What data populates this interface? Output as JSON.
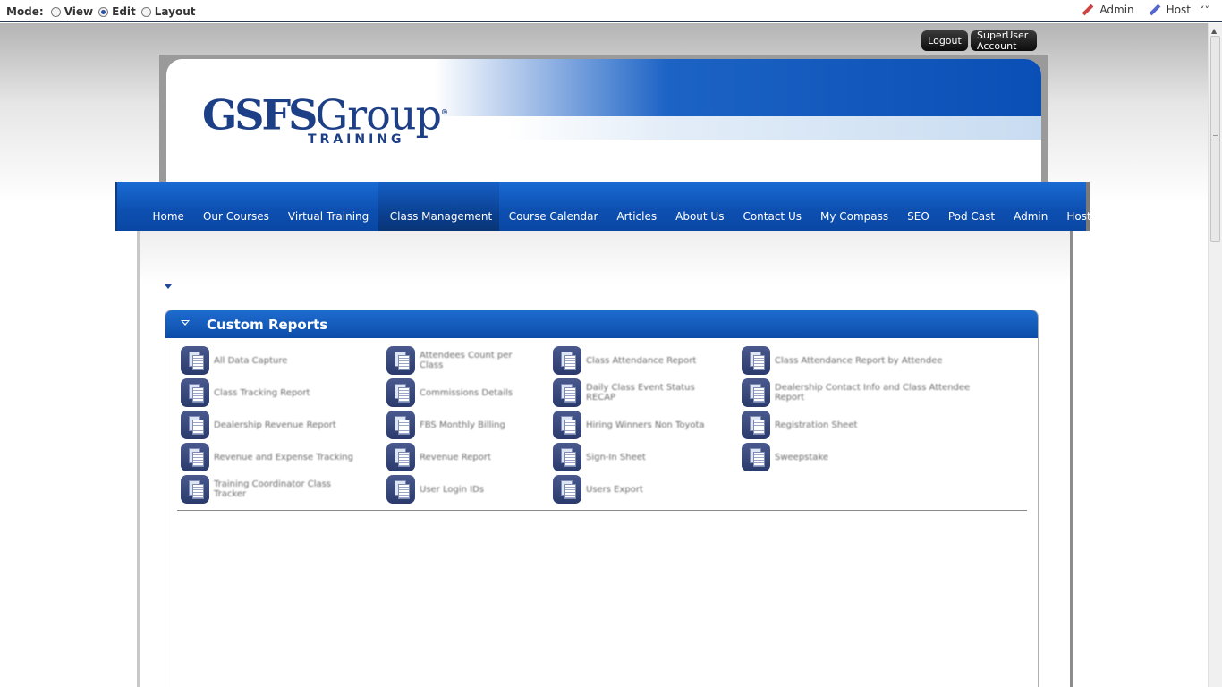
{
  "control_bar": {
    "mode_label": "Mode:",
    "modes": [
      {
        "label": "View",
        "selected": false
      },
      {
        "label": "Edit",
        "selected": true
      },
      {
        "label": "Layout",
        "selected": false
      }
    ],
    "links": [
      {
        "label": "Admin",
        "icon": "pencil-red-icon"
      },
      {
        "label": "Host",
        "icon": "pencil-blue-icon"
      }
    ],
    "collapse_glyph": "˅˅"
  },
  "account": {
    "logout_label": "Logout",
    "account_line1": "SuperUser",
    "account_line2": "Account"
  },
  "logo": {
    "main": "GSFS",
    "group": "Group",
    "registered": "®",
    "sub": "TRAINING"
  },
  "nav": {
    "items": [
      "Home",
      "Our Courses",
      "Virtual Training",
      "Class Management",
      "Course Calendar",
      "Articles",
      "About Us",
      "Contact Us",
      "My Compass",
      "SEO",
      "Pod Cast",
      "Admin",
      "Host"
    ],
    "active": "Class Management"
  },
  "reports": {
    "title": "Custom Reports",
    "items": [
      {
        "line1": "All Data Capture",
        "line2": ""
      },
      {
        "line1": "Attendees Count per",
        "line2": "Class"
      },
      {
        "line1": "Class Attendance Report",
        "line2": ""
      },
      {
        "line1": "Class Attendance Report by Attendee",
        "line2": ""
      },
      {
        "line1": "Class Tracking Report",
        "line2": ""
      },
      {
        "line1": "Commissions Details",
        "line2": ""
      },
      {
        "line1": "Daily Class Event Status",
        "line2": "RECAP"
      },
      {
        "line1": "Dealership Contact Info and Class Attendee",
        "line2": "Report"
      },
      {
        "line1": "Dealership Revenue Report",
        "line2": ""
      },
      {
        "line1": "FBS Monthly Billing",
        "line2": ""
      },
      {
        "line1": "Hiring Winners Non Toyota",
        "line2": ""
      },
      {
        "line1": "Registration Sheet",
        "line2": ""
      },
      {
        "line1": "Revenue and Expense Tracking",
        "line2": ""
      },
      {
        "line1": "Revenue Report",
        "line2": ""
      },
      {
        "line1": "Sign-In Sheet",
        "line2": ""
      },
      {
        "line1": "Sweepstake",
        "line2": ""
      },
      {
        "line1": "Training Coordinator Class",
        "line2": "Tracker"
      },
      {
        "line1": "User Login IDs",
        "line2": ""
      },
      {
        "line1": "Users Export",
        "line2": ""
      }
    ]
  },
  "colors": {
    "nav_blue": "#0d4fb0",
    "logo_navy": "#1d3f86",
    "active_nav": "#0a3e8d"
  }
}
